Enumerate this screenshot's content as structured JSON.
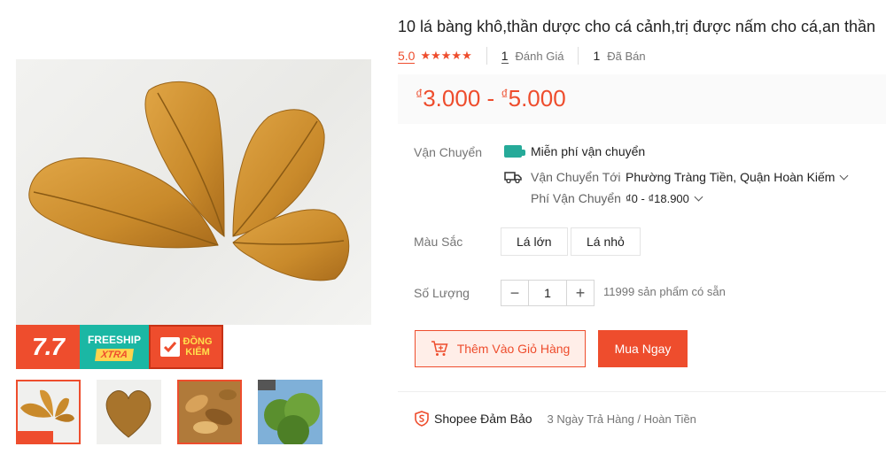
{
  "product": {
    "title": "10 lá bàng khô,thần dược cho cá cảnh,trị được nấm cho cá,an thần",
    "rating": "5.0",
    "stars": "★★★★★",
    "reviews_count": "1",
    "reviews_label": "Đánh Giá",
    "sold_count": "1",
    "sold_label": "Đã Bán"
  },
  "price": {
    "currency": "₫",
    "min": "3.000",
    "separator": " - ",
    "max": "5.000"
  },
  "shipping": {
    "label": "Vận Chuyển",
    "free_text": "Miễn phí vận chuyển",
    "free_icon_text": "Free",
    "to_label": "Vận Chuyển Tới",
    "to_value": "Phường Tràng Tiền, Quận Hoàn Kiếm",
    "fee_label": "Phí Vận Chuyển",
    "fee_value": "₫0 - ₫18.900"
  },
  "color": {
    "label": "Màu Sắc",
    "options": [
      "Lá lớn",
      "Lá nhỏ"
    ]
  },
  "quantity": {
    "label": "Số Lượng",
    "minus": "−",
    "value": "1",
    "plus": "+",
    "stock_text": "11999 sản phẩm có sẵn"
  },
  "actions": {
    "add_to_cart": "Thêm Vào Giỏ Hàng",
    "buy_now": "Mua Ngay"
  },
  "guarantee": {
    "title": "Shopee Đảm Bảo",
    "description": "3 Ngày Trả Hàng / Hoàn Tiền"
  },
  "promo": {
    "badge_77": "7.7",
    "freeship_top": "FREESHIP",
    "freeship_bottom": "XTRA",
    "dongkiem_line1": "ĐỒNG",
    "dongkiem_line2": "KIỂM"
  },
  "colors": {
    "accent": "#ee4d2d",
    "teal": "#26aa99",
    "leaf": "#c98a2b"
  }
}
